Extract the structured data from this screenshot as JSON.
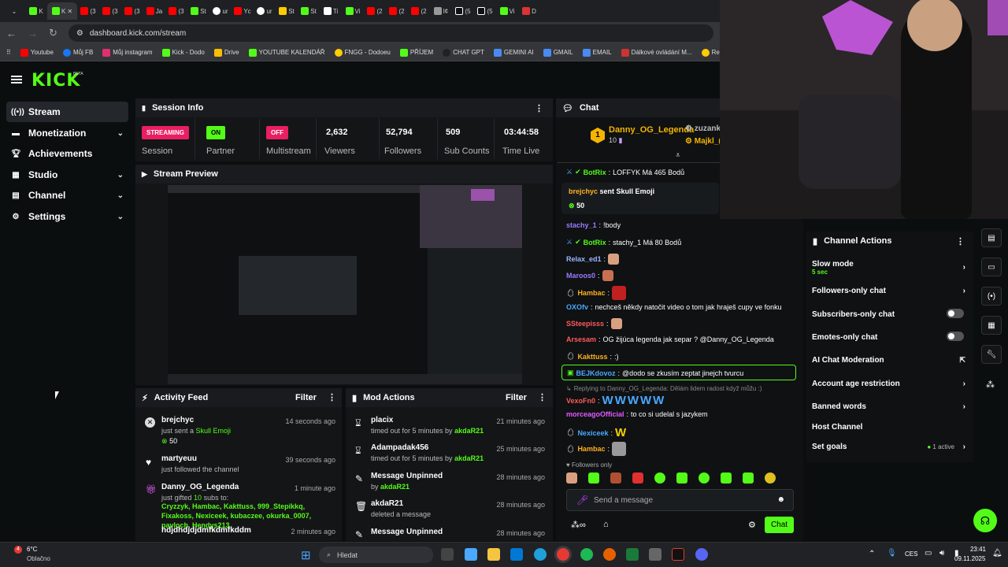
{
  "browser": {
    "tabs": [
      "K",
      "K",
      "(3",
      "(3",
      "(3",
      "Ja",
      "(3",
      "St",
      "ur",
      "Yc",
      "ur",
      "St",
      "St",
      "Ti",
      "Vi",
      "(2",
      "(2",
      "(2",
      "l¢",
      "(5",
      "(5",
      "Vi",
      "D"
    ],
    "url": "dashboard.kick.com/stream",
    "bookmarks": [
      "Youtube",
      "Můj FB",
      "Můj instagram",
      "Kick - Dodo",
      "Drive",
      "YOUTUBE KALENDÁŘ",
      "FNGG - Dodoeu",
      "PŘÍJEM",
      "CHAT GPT",
      "GEMINI AI",
      "GMAIL",
      "EMAIL",
      "Dálkové ovládání M...",
      "Re"
    ]
  },
  "kick": {
    "logo": "KICK",
    "beta": "BETA"
  },
  "sidebar": {
    "items": [
      {
        "label": "Stream",
        "icon": "broadcast-icon"
      },
      {
        "label": "Monetization",
        "icon": "money-icon"
      },
      {
        "label": "Achievements",
        "icon": "trophy-icon"
      },
      {
        "label": "Studio",
        "icon": "studio-icon"
      },
      {
        "label": "Channel",
        "icon": "channel-icon"
      },
      {
        "label": "Settings",
        "icon": "gear-icon"
      }
    ]
  },
  "session": {
    "title": "Session Info",
    "stats": [
      {
        "badge": "STREAMING",
        "label": "Session"
      },
      {
        "badge": "ON",
        "label": "Partner"
      },
      {
        "badge": "OFF",
        "label": "Multistream"
      },
      {
        "value": "2,632",
        "label": "Viewers"
      },
      {
        "value": "52,794",
        "label": "Followers"
      },
      {
        "value": "509",
        "label": "Sub Counts"
      },
      {
        "value": "03:44:58",
        "label": "Time Live"
      }
    ]
  },
  "preview": {
    "title": "Stream Preview"
  },
  "activity": {
    "title": "Activity Feed",
    "filter": "Filter",
    "items": [
      {
        "name": "brejchyc",
        "text": "just sent a",
        "highlight": "Skull Emoji",
        "extra": "50",
        "time": "14 seconds ago"
      },
      {
        "name": "martyeuu",
        "text": "just followed the channel",
        "time": "39 seconds ago"
      },
      {
        "name": "Danny_OG_Legenda",
        "text": "just gifted",
        "count": "10",
        "text2": "subs to:",
        "recipients": "Cryzzyk, Hambac, Kakttuss, 999_Stepikkq, Fixakoss, Nexiceek, kubaczee, okurka_0007, pavloch, Hendys213",
        "time": "1 minute ago"
      },
      {
        "name": "hdjdhdjdjdmfkdmfkddm",
        "time": "2 minutes ago"
      }
    ]
  },
  "mod": {
    "title": "Mod Actions",
    "filter": "Filter",
    "items": [
      {
        "name": "placix",
        "text": "timed out for 5 minutes by",
        "by": "akdaR21",
        "time": "21 minutes ago"
      },
      {
        "name": "Adampadak456",
        "text": "timed out for 5 minutes by",
        "by": "akdaR21",
        "time": "25 minutes ago"
      },
      {
        "name": "Message Unpinned",
        "text": "by",
        "by": "akdaR21",
        "time": "28 minutes ago"
      },
      {
        "name": "akdaR21",
        "text": "deleted a message",
        "time": "28 minutes ago"
      },
      {
        "name": "Message Unpinned",
        "time": "28 minutes ago"
      }
    ]
  },
  "chat": {
    "title": "Chat",
    "top_gifter": {
      "rank": "1",
      "name": "Danny_OG_Legenda",
      "count": "10"
    },
    "top_others": [
      "zuzank",
      "Majkl_("
    ],
    "pinned_user": "brejchyc",
    "pinned_text": "sent Skull Emoji",
    "pinned_amount": "50",
    "messages": [
      {
        "user": "BotRix",
        "color": "#53fc18",
        "text": "LOFFYK Má 465 Bodů"
      },
      {
        "user": "stachy_1",
        "color": "#9b7bff",
        "text": "!body"
      },
      {
        "user": "BotRix",
        "color": "#53fc18",
        "text": "stachy_1 Má 80 Bodů"
      },
      {
        "user": "Relax_ed1",
        "color": "#9bb5ff",
        "text": ""
      },
      {
        "user": "Maroos0",
        "color": "#9b7bff",
        "text": ""
      },
      {
        "user": "Hambac",
        "color": "#ffb020",
        "text": ""
      },
      {
        "user": "OXOfv",
        "color": "#4aa8ff",
        "text": "nechceš někdy natočit video o tom jak hraješ cupy ve fonku"
      },
      {
        "user": "SSteepisss",
        "color": "#ff5a5a",
        "text": ""
      },
      {
        "user": "Arsesam",
        "color": "#ff5a5a",
        "text": "OG žijúca legenda jak separ ? @Danny_OG_Legenda"
      },
      {
        "user": "Kakttuss",
        "color": "#ffb020",
        "text": ":)"
      },
      {
        "user": "BEJKdovoz",
        "color": "#4aa8ff",
        "text": "@dodo se zkusím zeptat jinejch tvurcu"
      },
      {
        "user": "VexoFn0",
        "color": "#ff5a5a",
        "text": "",
        "reply": "Replying to Danny_OG_Legenda: Dělám lidem radost když můžu :)"
      },
      {
        "user": "morceagoOfficial",
        "color": "#e45aff",
        "text": "to co si udelal s jazykem"
      },
      {
        "user": "Nexiceek",
        "color": "#4aa8ff",
        "text": ""
      },
      {
        "user": "Hambac",
        "color": "#ffb020",
        "text": ""
      }
    ],
    "followers_only": "Followers only",
    "placeholder": "Send a message",
    "send": "Chat"
  },
  "channel_actions": {
    "title": "Channel Actions",
    "items": [
      {
        "label": "Slow mode",
        "sub": "5 sec",
        "kind": "arrow"
      },
      {
        "label": "Followers-only chat",
        "kind": "arrow"
      },
      {
        "label": "Subscribers-only chat",
        "kind": "toggle"
      },
      {
        "label": "Emotes-only chat",
        "kind": "toggle"
      },
      {
        "label": "AI Chat Moderation",
        "kind": "external"
      },
      {
        "label": "Account age restriction",
        "kind": "arrow"
      },
      {
        "label": "Banned words",
        "kind": "arrow"
      },
      {
        "label": "Host Channel",
        "kind": "none"
      },
      {
        "label": "Set goals",
        "extra": "1 active",
        "kind": "arrow"
      }
    ]
  },
  "taskbar": {
    "weather_temp": "6°C",
    "weather_desc": "Oblačno",
    "search": "Hledat",
    "lang": "CES",
    "time": "23:41",
    "date": "09.11.2025"
  },
  "colors": {
    "kick_green": "#53fc18",
    "panel": "#141517",
    "bg": "#0b0e0f"
  }
}
